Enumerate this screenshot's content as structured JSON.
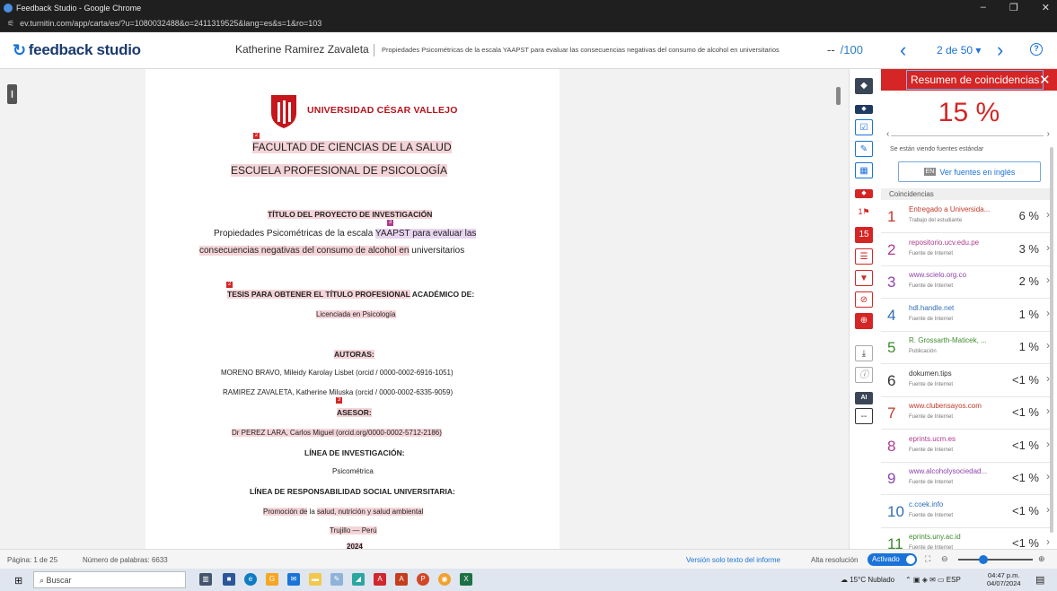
{
  "window": {
    "title": "Feedback Studio - Google Chrome",
    "url": "ev.turnitin.com/app/carta/es/?u=1080032488&o=2411319525&lang=es&s=1&ro=103"
  },
  "header": {
    "brand": "feedback studio",
    "author": "Katherine Ramirez Zavaleta",
    "doc_title": "Propiedades Psicométricas de la escala YAAPST para evaluar las consecuencias negativas del consumo de alcohol en universitarios",
    "grade": "--",
    "grade_total": "/100",
    "pager": "2 de 50 ▾"
  },
  "document": {
    "university": "UNIVERSIDAD CÉSAR VALLEJO",
    "faculty": "FACULTAD DE CIENCIAS DE LA SALUD",
    "school": "ESCUELA PROFESIONAL DE PSICOLOGÍA",
    "title_label": "TÍTULO DEL PROYECTO DE INVESTIGACIÓN",
    "title_line1a": "Propiedades Psicométricas de la escala ",
    "title_line1b": "YAAPST para evaluar las",
    "title_line2a": "consecuencias negativas del consumo de alcohol en",
    "title_line2b": " universitarios",
    "thesis_a": "TESIS PARA OBTENER EL TÍTULO PROFESIONAL",
    "thesis_b": " ACADÉMICO DE:",
    "degree": "Licenciada en Psicología",
    "authors_label": "AUTORAS:",
    "author1": "MORENO BRAVO, Mileidy Karolay Lisbet (orcid / 0000-0002-6916-1051)",
    "author2": "RAMIREZ ZAVALETA, Katherine Miluska (orcid / 0000-0002-6335-9059)",
    "advisor_label": "ASESOR:",
    "advisor": "Dr  PEREZ LARA, Carlos Miguel (orcid.org/0000-0002-5712-2186)",
    "line_label": "LÍNEA DE INVESTIGACIÓN:",
    "line": "Psicométrica",
    "social_label": "LÍNEA DE RESPONSABILIDAD SOCIAL UNIVERSITARIA:",
    "social_a": "Promoción de",
    "social_b": " la ",
    "social_c": "salud, nutrición y salud ambiental",
    "place": "Trujillo — Perú",
    "year": "2024",
    "markers": [
      "2",
      "3",
      "2",
      "3"
    ]
  },
  "toolstrip": {
    "match_count": "15",
    "flag_count": "1",
    "ai_label": "AI",
    "ai_value": "--"
  },
  "panel": {
    "title": "Resumen de coincidencias",
    "percent": "15 %",
    "std_note": "Se están viendo fuentes estándar",
    "en_badge": "EN",
    "english_button": "Ver fuentes en inglés",
    "section_label": "Coincidencias",
    "matches": [
      {
        "num": "1",
        "source": "Entregado a Universida...",
        "kind": "Trabajo del estudiante",
        "pct": "6 %",
        "color": "#c0392b"
      },
      {
        "num": "2",
        "source": "repositorio.ucv.edu.pe",
        "kind": "Fuente de Internet",
        "pct": "3 %",
        "color": "#b03a8c"
      },
      {
        "num": "3",
        "source": "www.scielo.org.co",
        "kind": "Fuente de Internet",
        "pct": "2 %",
        "color": "#8e44ad"
      },
      {
        "num": "4",
        "source": "hdl.handle.net",
        "kind": "Fuente de Internet",
        "pct": "1 %",
        "color": "#2e6fb5"
      },
      {
        "num": "5",
        "source": "R. Grossarth-Maticek, ...",
        "kind": "Publicación",
        "pct": "1 %",
        "color": "#3d8c2e"
      },
      {
        "num": "6",
        "source": "dokumen.tips",
        "kind": "Fuente de Internet",
        "pct": "<1 %",
        "color": "#333333"
      },
      {
        "num": "7",
        "source": "www.clubensayos.com",
        "kind": "Fuente de Internet",
        "pct": "<1 %",
        "color": "#c0392b"
      },
      {
        "num": "8",
        "source": "eprints.ucm.es",
        "kind": "Fuente de Internet",
        "pct": "<1 %",
        "color": "#b03a8c"
      },
      {
        "num": "9",
        "source": "www.alcoholysociedad...",
        "kind": "Fuente de Internet",
        "pct": "<1 %",
        "color": "#8e44ad"
      },
      {
        "num": "10",
        "source": "c.coek.info",
        "kind": "Fuente de Internet",
        "pct": "<1 %",
        "color": "#2e6fb5"
      },
      {
        "num": "11",
        "source": "eprints.uny.ac.id",
        "kind": "Fuente de Internet",
        "pct": "<1 %",
        "color": "#3d8c2e"
      }
    ]
  },
  "status": {
    "page": "Página: 1 de 25",
    "words": "Número de palabras: 6633",
    "text_only": "Versión solo texto del informe",
    "hires": "Alta resolución",
    "toggle": "Activado"
  },
  "taskbar": {
    "search": "Buscar",
    "weather": "15°C  Nublado",
    "lang": "ESP",
    "time": "04:47 p.m.",
    "date": "04/07/2024"
  },
  "colors": {
    "accent": "#1a73d9",
    "brand_red": "#d52525",
    "ucv_red": "#b8121c"
  }
}
